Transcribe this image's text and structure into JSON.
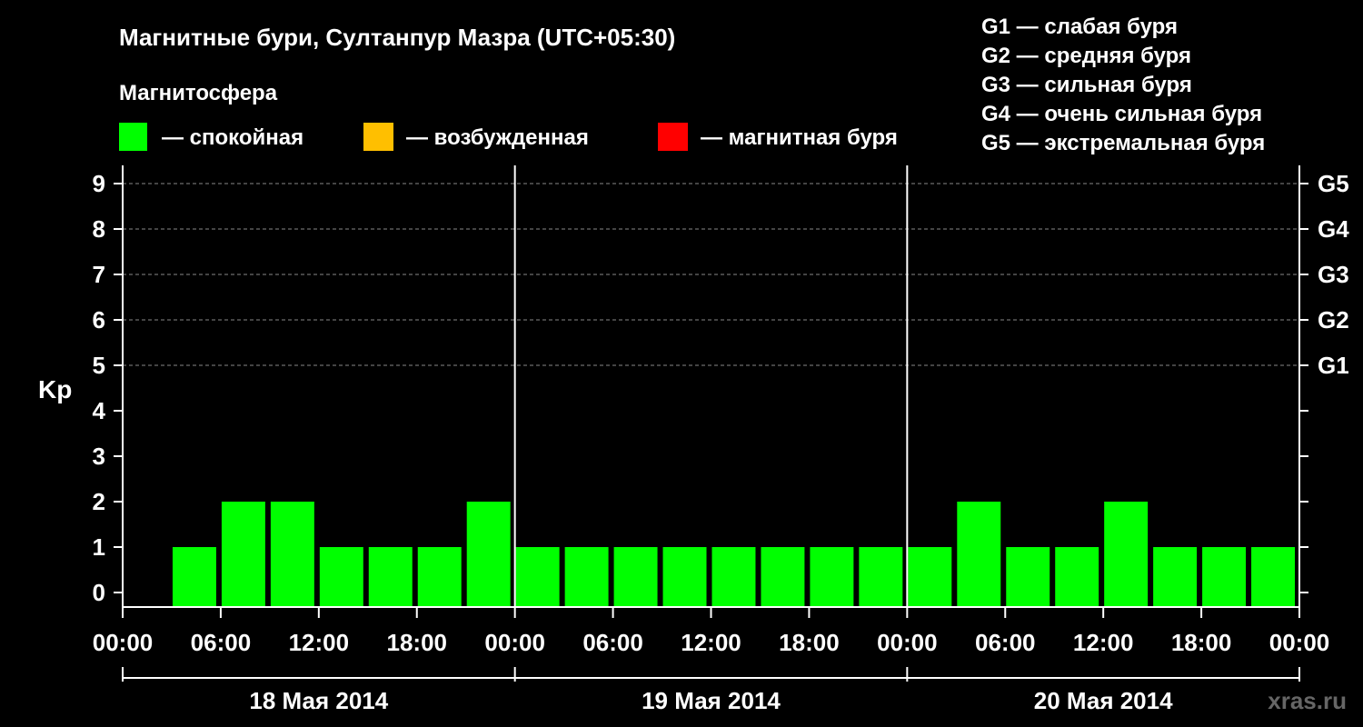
{
  "header": {
    "title": "Магнитные бури, Султанпур Мазра (UTC+05:30)",
    "magnetosphere_label": "Магнитосфера"
  },
  "legend": {
    "states": [
      {
        "label": "— спокойная",
        "color": "#00ff00"
      },
      {
        "label": "— возбужденная",
        "color": "#ffbf00"
      },
      {
        "label": "— магнитная буря",
        "color": "#ff0000"
      }
    ],
    "storm_levels": [
      "G1 — слабая буря",
      "G2 — средняя буря",
      "G3 — сильная буря",
      "G4 — очень сильная буря",
      "G5 — экстремальная буря"
    ]
  },
  "watermark": "xras.ru",
  "chart_data": {
    "type": "bar",
    "ylabel": "Kp",
    "ylim": [
      0,
      9
    ],
    "y_ticks": [
      "0",
      "1",
      "2",
      "3",
      "4",
      "5",
      "6",
      "7",
      "8",
      "9"
    ],
    "g_scale": [
      {
        "kp": 5,
        "label": "G1"
      },
      {
        "kp": 6,
        "label": "G2"
      },
      {
        "kp": 7,
        "label": "G3"
      },
      {
        "kp": 8,
        "label": "G4"
      },
      {
        "kp": 9,
        "label": "G5"
      }
    ],
    "grid_dashed_from_kp": 5,
    "x_tick_labels": [
      "00:00",
      "06:00",
      "12:00",
      "18:00",
      "00:00",
      "06:00",
      "12:00",
      "18:00",
      "00:00",
      "06:00",
      "12:00",
      "18:00",
      "00:00"
    ],
    "days": [
      "18 Мая 2014",
      "19 Мая 2014",
      "20 Мая 2014"
    ],
    "bar_color": "#00ff00",
    "series": [
      {
        "values": [
          1,
          2,
          2,
          1,
          1,
          1,
          2,
          1,
          1,
          1,
          1,
          1,
          1,
          1,
          1,
          1,
          2,
          1,
          1,
          2,
          1,
          1,
          1
        ]
      }
    ]
  }
}
